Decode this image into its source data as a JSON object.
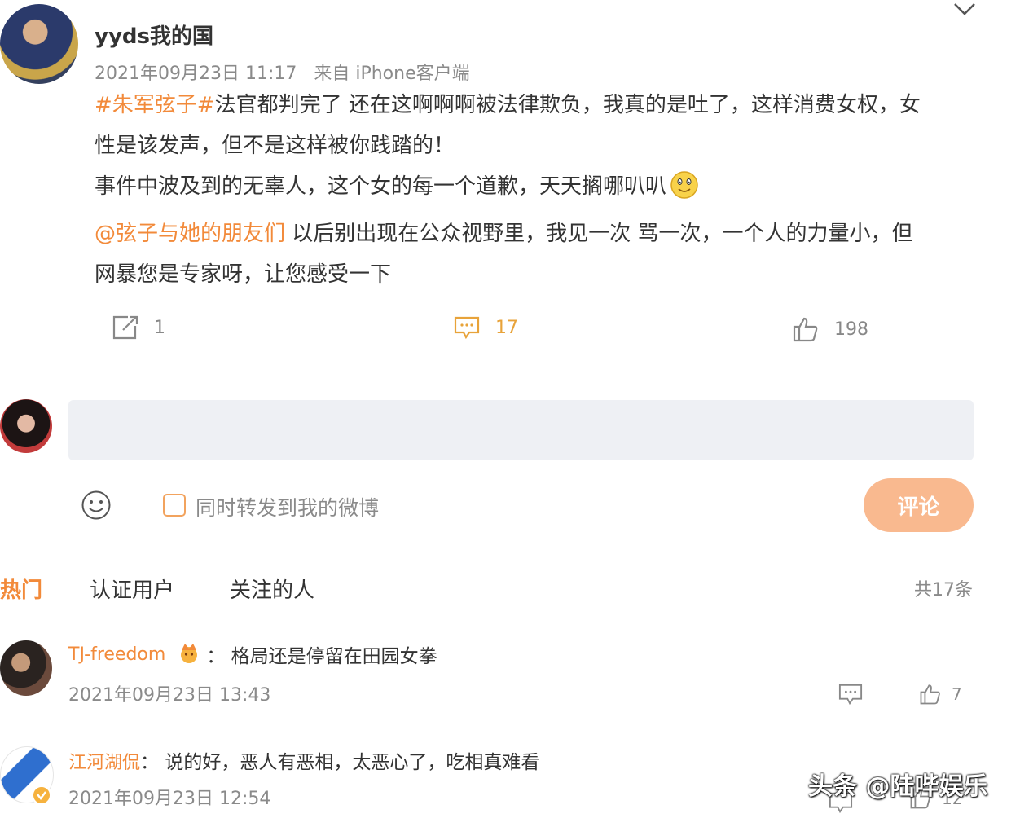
{
  "post": {
    "user_name": "yyds我的国",
    "timestamp": "2021年09月23日 11:17",
    "source": "来自 iPhone客户端",
    "lines": {
      "l1_tag": "#朱军弦子#",
      "l1_text": "法官都判完了 还在这啊啊啊被法律欺负，我真的是吐了，这样消费女权，女",
      "l2_text": "性是该发声，但不是这样被你践踏的！",
      "l3_text": "事件中波及到的无辜人，这个女的每一个道歉，天天搁哪叭叭",
      "l4_mention": "@弦子与她的朋友们",
      "l4_text": " 以后别出现在公众视野里，我见一次 骂一次，一个人的力量小，但",
      "l5_text": "网暴您是专家呀，让您感受一下"
    },
    "actions": {
      "repost_count": "1",
      "comment_count": "17",
      "like_count": "198"
    }
  },
  "composer": {
    "repost_label": "同时转发到我的微博",
    "submit_label": "评论"
  },
  "tabs": {
    "hot": "热门",
    "verified": "认证用户",
    "following": "关注的人",
    "total": "共17条"
  },
  "comments": [
    {
      "name": "TJ-freedom",
      "text": "：  格局还是停留在田园女拳",
      "time": "2021年09月23日 13:43",
      "like_count": "7"
    },
    {
      "name": "江河湖侃",
      "text": "：  说的好，恶人有恶相，太恶心了，吃相真难看",
      "time": "2021年09月23日 12:54",
      "like_count": "12"
    }
  ],
  "watermark": "头条 @陆哔娱乐",
  "colors": {
    "accent": "#f28a3a",
    "comment_accent": "#e8a33a",
    "button": "#f9b98f"
  }
}
